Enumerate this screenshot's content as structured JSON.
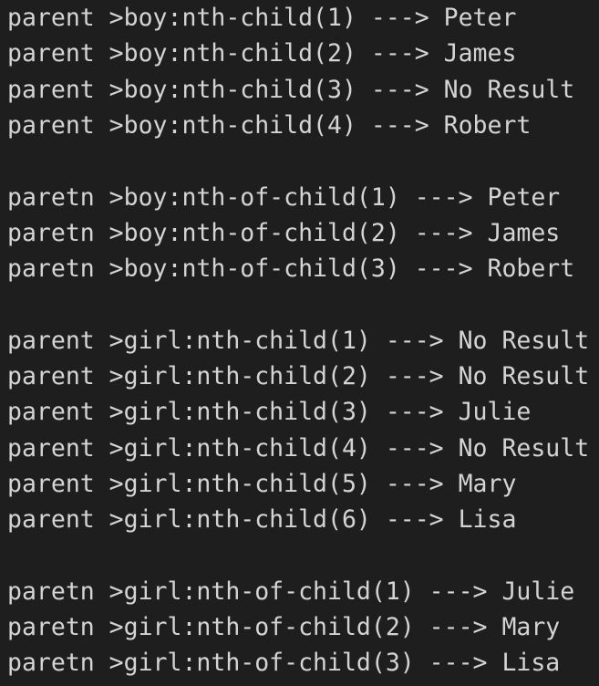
{
  "lines": [
    "parent >boy:nth-child(1) ---> Peter",
    "parent >boy:nth-child(2) ---> James",
    "parent >boy:nth-child(3) ---> No Result",
    "parent >boy:nth-child(4) ---> Robert",
    "",
    "paretn >boy:nth-of-child(1) ---> Peter",
    "paretn >boy:nth-of-child(2) ---> James",
    "paretn >boy:nth-of-child(3) ---> Robert",
    "",
    "parent >girl:nth-child(1) ---> No Result",
    "parent >girl:nth-child(2) ---> No Result",
    "parent >girl:nth-child(3) ---> Julie",
    "parent >girl:nth-child(4) ---> No Result",
    "parent >girl:nth-child(5) ---> Mary",
    "parent >girl:nth-child(6) ---> Lisa",
    "",
    "paretn >girl:nth-of-child(1) ---> Julie",
    "paretn >girl:nth-of-child(2) ---> Mary",
    "paretn >girl:nth-of-child(3) ---> Lisa"
  ],
  "colors": {
    "background": "#1e1e1e",
    "text": "#d4d4d4"
  }
}
